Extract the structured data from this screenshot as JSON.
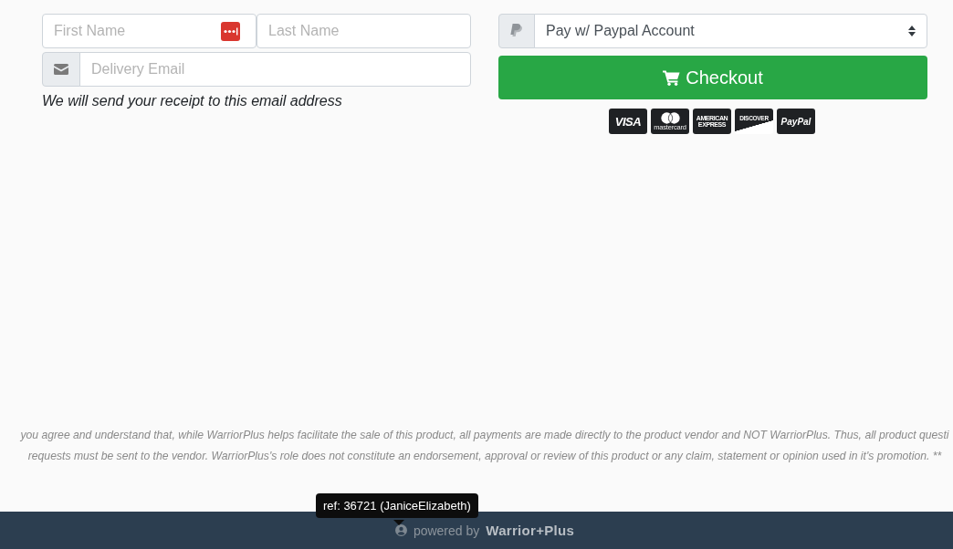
{
  "contact_form": {
    "first_name": {
      "placeholder": "First Name"
    },
    "last_name": {
      "placeholder": "Last Name"
    },
    "email": {
      "placeholder": "Delivery Email"
    },
    "email_note": "We will send your receipt to this email address"
  },
  "payment": {
    "method_select": {
      "value": "Pay w/ Paypal Account"
    },
    "checkout_button": {
      "label": "Checkout"
    },
    "card_logos": [
      {
        "kind": "visa",
        "label": "VISA"
      },
      {
        "kind": "mastercard",
        "label": "mastercard"
      },
      {
        "kind": "amex",
        "label": "AMERICAN EXPRESS"
      },
      {
        "kind": "discover",
        "label": "DISCOVER"
      },
      {
        "kind": "paypal",
        "label": "PayPal"
      }
    ]
  },
  "disclaimer": {
    "lines": [
      "you agree and understand that, while WarriorPlus helps facilitate the sale of this product, all payments are made directly to the product vendor and NOT WarriorPlus. Thus, all product questi",
      "requests must be sent to the vendor. WarriorPlus's role does not constitute an endorsement, approval or review of this product or any claim, statement or opinion used in it's promotion. **"
    ]
  },
  "tooltip": {
    "text": "ref: 36721 (JaniceElizabeth)"
  },
  "footer": {
    "powered_by": "powered by",
    "brand": "Warrior+Plus"
  }
}
